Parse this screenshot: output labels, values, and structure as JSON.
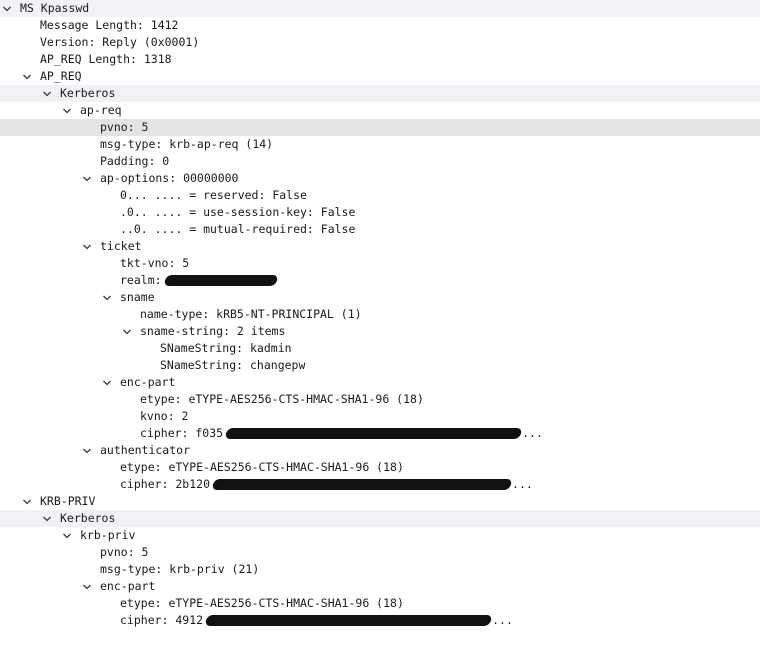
{
  "tree": [
    {
      "id": "ms-kpasswd",
      "depth": 0,
      "exp": true,
      "label": "MS Kpasswd",
      "band": true
    },
    {
      "id": "message-length",
      "depth": 1,
      "exp": null,
      "label": "Message Length: 1412"
    },
    {
      "id": "version",
      "depth": 1,
      "exp": null,
      "label": "Version: Reply (0x0001)"
    },
    {
      "id": "ap-req-length",
      "depth": 1,
      "exp": null,
      "label": "AP_REQ Length: 1318"
    },
    {
      "id": "ap-req-group",
      "depth": 1,
      "exp": true,
      "label": "AP_REQ"
    },
    {
      "id": "kerberos-1",
      "depth": 2,
      "exp": true,
      "label": "Kerberos",
      "band": true
    },
    {
      "id": "ap-req",
      "depth": 3,
      "exp": true,
      "label": "ap-req"
    },
    {
      "id": "pvno-1",
      "depth": 4,
      "exp": null,
      "label": "pvno: 5",
      "selected": true
    },
    {
      "id": "msg-type-1",
      "depth": 4,
      "exp": null,
      "label": "msg-type: krb-ap-req (14)"
    },
    {
      "id": "padding",
      "depth": 4,
      "exp": null,
      "label": "Padding: 0"
    },
    {
      "id": "ap-options",
      "depth": 4,
      "exp": true,
      "label": "ap-options: 00000000"
    },
    {
      "id": "reserved",
      "depth": 5,
      "exp": null,
      "label": "0... .... = reserved: False"
    },
    {
      "id": "use-session-key",
      "depth": 5,
      "exp": null,
      "label": ".0.. .... = use-session-key: False"
    },
    {
      "id": "mutual-required",
      "depth": 5,
      "exp": null,
      "label": "..0. .... = mutual-required: False"
    },
    {
      "id": "ticket",
      "depth": 4,
      "exp": true,
      "label": "ticket"
    },
    {
      "id": "tkt-vno",
      "depth": 5,
      "exp": null,
      "label": "tkt-vno: 5"
    },
    {
      "id": "realm",
      "depth": 5,
      "exp": null,
      "label": "realm:",
      "redact": 112
    },
    {
      "id": "sname",
      "depth": 5,
      "exp": true,
      "label": "sname"
    },
    {
      "id": "name-type",
      "depth": 6,
      "exp": null,
      "label": "name-type: kRB5-NT-PRINCIPAL (1)"
    },
    {
      "id": "sname-string",
      "depth": 6,
      "exp": true,
      "label": "sname-string: 2 items"
    },
    {
      "id": "snamestring-kadmin",
      "depth": 7,
      "exp": null,
      "label": "SNameString: kadmin"
    },
    {
      "id": "snamestring-changepw",
      "depth": 7,
      "exp": null,
      "label": "SNameString: changepw"
    },
    {
      "id": "enc-part-ticket",
      "depth": 5,
      "exp": true,
      "label": "enc-part"
    },
    {
      "id": "etype-ticket",
      "depth": 6,
      "exp": null,
      "label": "etype: eTYPE-AES256-CTS-HMAC-SHA1-96 (18)"
    },
    {
      "id": "kvno",
      "depth": 6,
      "exp": null,
      "label": "kvno: 2"
    },
    {
      "id": "cipher-ticket",
      "depth": 6,
      "exp": null,
      "label": "cipher: f035",
      "redact": 295,
      "tail": "..."
    },
    {
      "id": "authenticator",
      "depth": 4,
      "exp": true,
      "label": "authenticator"
    },
    {
      "id": "etype-auth",
      "depth": 5,
      "exp": null,
      "label": "etype: eTYPE-AES256-CTS-HMAC-SHA1-96 (18)"
    },
    {
      "id": "cipher-auth",
      "depth": 5,
      "exp": null,
      "label": "cipher: 2b120",
      "redact": 298,
      "tail": "..."
    },
    {
      "id": "krb-priv-group",
      "depth": 1,
      "exp": true,
      "label": "KRB-PRIV"
    },
    {
      "id": "kerberos-2",
      "depth": 2,
      "exp": true,
      "label": "Kerberos",
      "band": true
    },
    {
      "id": "krb-priv",
      "depth": 3,
      "exp": true,
      "label": "krb-priv"
    },
    {
      "id": "pvno-2",
      "depth": 4,
      "exp": null,
      "label": "pvno: 5"
    },
    {
      "id": "msg-type-2",
      "depth": 4,
      "exp": null,
      "label": "msg-type: krb-priv (21)"
    },
    {
      "id": "enc-part-priv",
      "depth": 4,
      "exp": true,
      "label": "enc-part"
    },
    {
      "id": "etype-priv",
      "depth": 5,
      "exp": null,
      "label": "etype: eTYPE-AES256-CTS-HMAC-SHA1-96 (18)"
    },
    {
      "id": "cipher-priv",
      "depth": 5,
      "exp": null,
      "label": "cipher: 4912",
      "redact": 285,
      "tail": "..."
    }
  ]
}
